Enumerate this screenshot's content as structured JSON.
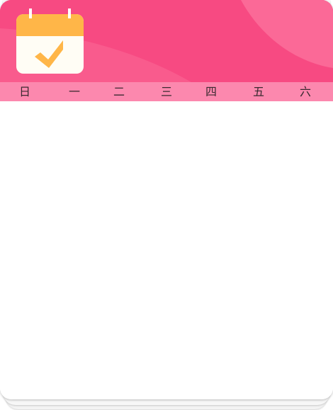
{
  "header": {
    "icon": "calendar-check-icon",
    "background_color": "#f74a82",
    "accent_color": "#ffb648"
  },
  "weekdays": [
    "日",
    "一",
    "二",
    "三",
    "四",
    "五",
    "六"
  ],
  "weekbar_color": "#fc88ae"
}
